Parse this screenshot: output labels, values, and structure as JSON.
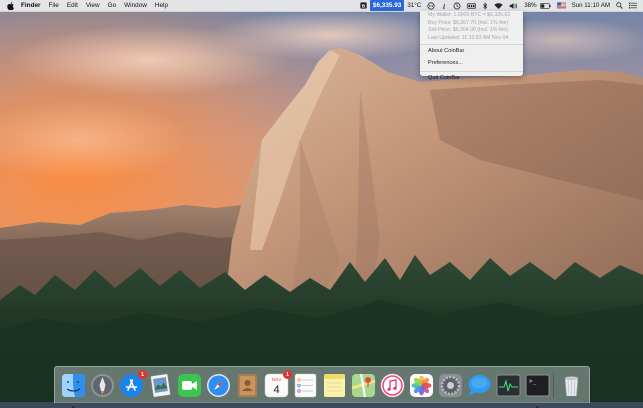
{
  "menubar": {
    "apple_icon": "apple-logo-icon",
    "app_name": "Finder",
    "menus": [
      "File",
      "Edit",
      "View",
      "Go",
      "Window",
      "Help"
    ],
    "status": {
      "price": "$6,335.93",
      "temperature": "31°C",
      "battery": "38%",
      "clock": "Sun 11:10 AM"
    }
  },
  "coinbar_menu": {
    "info": [
      "My Wallet: 1.0000 BTC = $6,335.62",
      "Buy Price: $6,367.70 (Incl. 1% fee)",
      "Sell Price: $6,304.00 (Incl. 1% fee)",
      "Last Updated: 11:10:53 AM Nov 04"
    ],
    "actions": [
      "About CoinBar",
      "Preferences...",
      "Quit CoinBar"
    ]
  },
  "dock": {
    "items": [
      {
        "name": "Finder",
        "icon": "finder-icon"
      },
      {
        "name": "Launchpad",
        "icon": "launchpad-icon"
      },
      {
        "name": "App Store",
        "icon": "app-store-icon",
        "badge": "1"
      },
      {
        "name": "Preview",
        "icon": "preview-icon"
      },
      {
        "name": "FaceTime",
        "icon": "facetime-icon"
      },
      {
        "name": "Safari",
        "icon": "safari-icon"
      },
      {
        "name": "Contacts",
        "icon": "contacts-icon"
      },
      {
        "name": "Calendar",
        "icon": "calendar-icon",
        "month": "NOV",
        "day": "4",
        "badge": "1"
      },
      {
        "name": "Reminders",
        "icon": "reminders-icon"
      },
      {
        "name": "Notes",
        "icon": "notes-icon"
      },
      {
        "name": "Maps",
        "icon": "maps-icon"
      },
      {
        "name": "iTunes",
        "icon": "itunes-icon"
      },
      {
        "name": "Photos",
        "icon": "photos-icon"
      },
      {
        "name": "System Preferences",
        "icon": "system-preferences-icon"
      },
      {
        "name": "Messages",
        "icon": "messages-icon"
      },
      {
        "name": "Activity Monitor",
        "icon": "activity-monitor-icon"
      },
      {
        "name": "Terminal",
        "icon": "terminal-icon",
        "prompt": ">_"
      },
      {
        "name": "Trash",
        "icon": "trash-icon"
      }
    ]
  },
  "colors": {
    "price_chip": "#2b67d8",
    "badge": "#e3312b",
    "sky_top": "#7d8fb0",
    "sky_glow": "#f09a52"
  }
}
